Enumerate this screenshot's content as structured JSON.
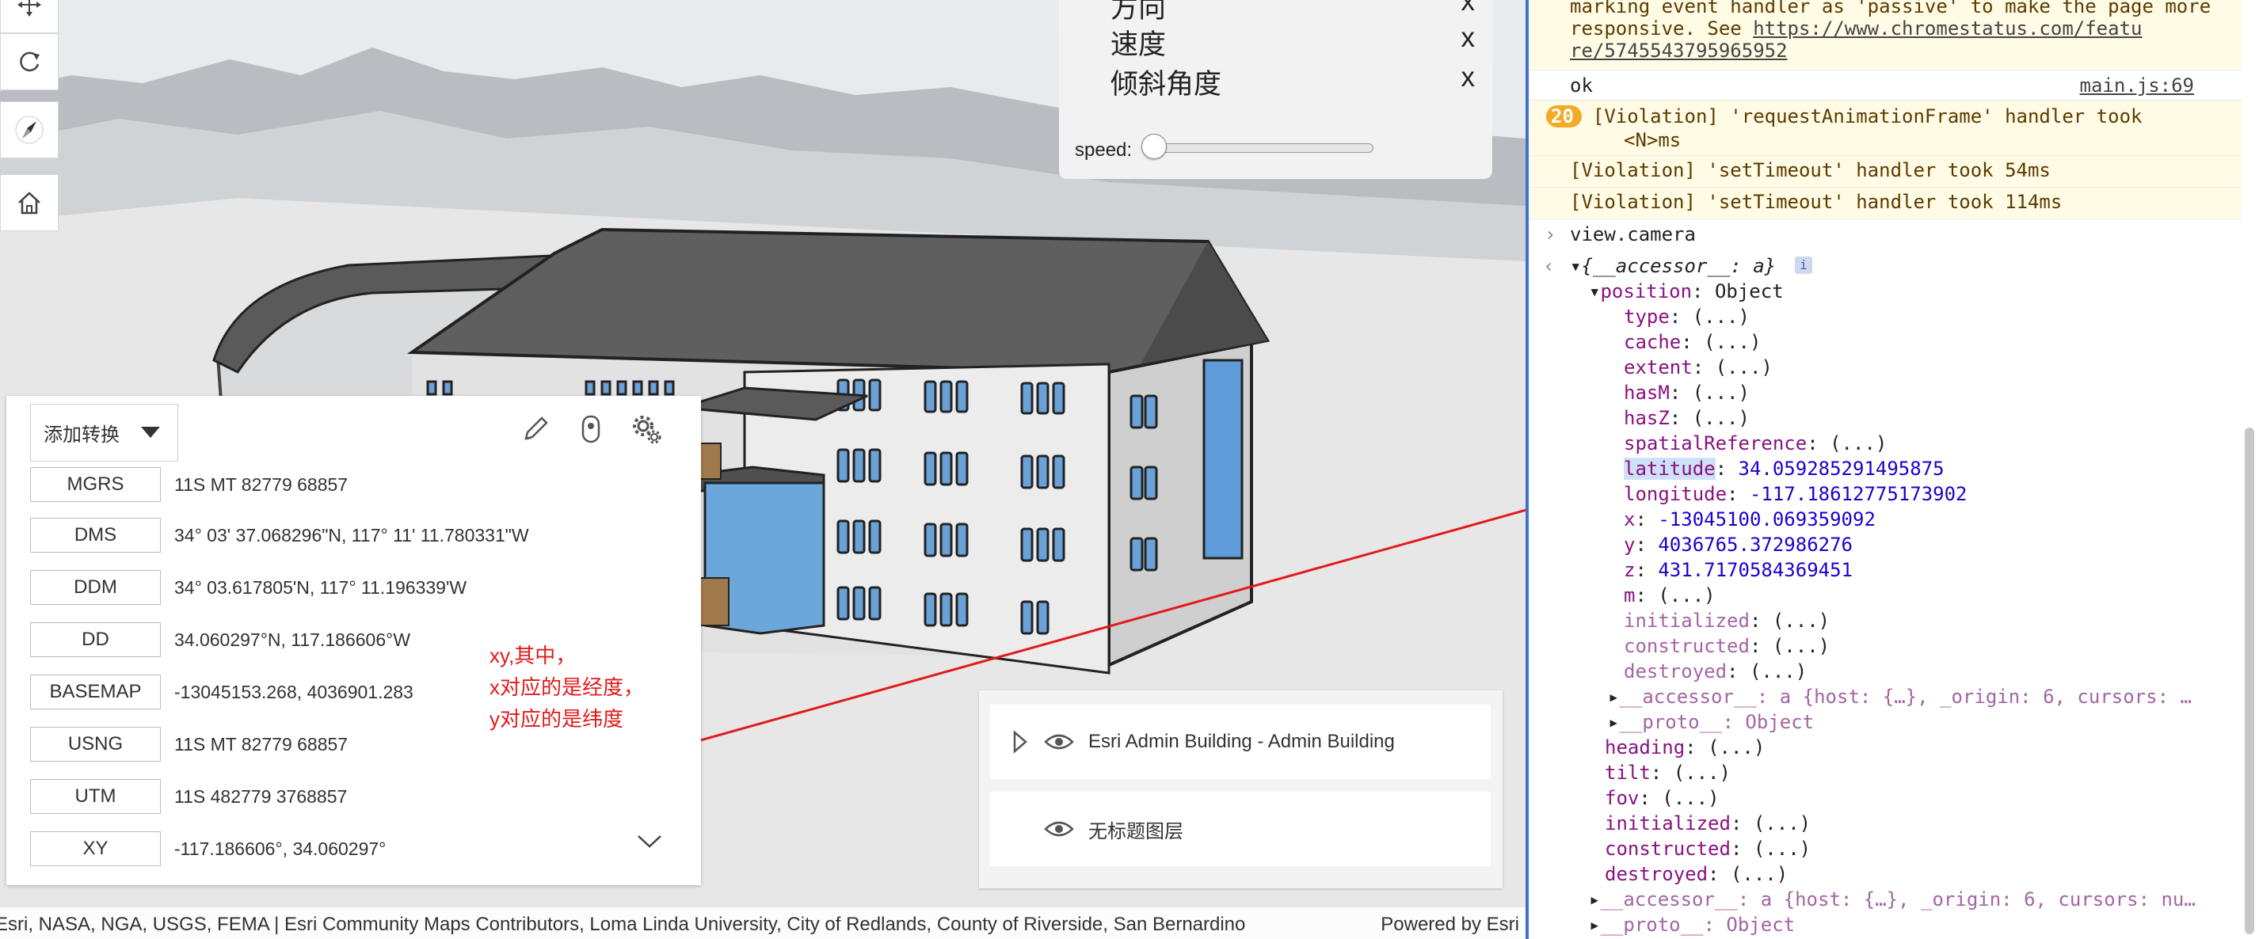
{
  "coordinate_widget": {
    "add_conversion_label": "添加转换",
    "rows": [
      {
        "format": "MGRS",
        "value": "11S MT 82779 68857"
      },
      {
        "format": "DMS",
        "value": "34° 03' 37.068296\"N, 117° 11' 11.780331\"W"
      },
      {
        "format": "DDM",
        "value": "34° 03.617805'N, 117° 11.196339'W"
      },
      {
        "format": "DD",
        "value": "34.060297°N, 117.186606°W"
      },
      {
        "format": "BASEMAP",
        "value": "-13045153.268, 4036901.283"
      },
      {
        "format": "USNG",
        "value": "11S MT 82779 68857"
      },
      {
        "format": "UTM",
        "value": "11S 482779 3768857"
      },
      {
        "format": "XY",
        "value": "-117.186606°, 34.060297°"
      }
    ]
  },
  "annotation": {
    "line1": "xy,其中，",
    "line2": "x对应的是经度，",
    "line3": "y对应的是纬度",
    "color": "#e21a1a"
  },
  "animation_panel": {
    "rows": [
      {
        "label": "方向",
        "close": "x"
      },
      {
        "label": "速度",
        "close": "x"
      },
      {
        "label": "倾斜角度",
        "close": "x"
      }
    ],
    "speed_label": "speed:",
    "speed_value": 0
  },
  "layer_list": {
    "layers": [
      {
        "title": "Esri Admin Building - Admin Building"
      },
      {
        "title": "无标题图层"
      }
    ]
  },
  "attribution": {
    "text": "Esri, NASA, NGA, USGS, FEMA | Esri Community Maps Contributors, Loma Linda University, City of Redlands, County of Riverside, San Bernardino",
    "powered_by": "Powered by Esri"
  },
  "console": {
    "warn_text": "marking event handler as 'passive' to make the page more responsive. See ",
    "warn_link_1": "https://www.chromestatus.com/featu",
    "warn_link_2": "re/5745543795965952",
    "ok_text": "ok",
    "ok_source": "main.js:69",
    "badge_count": "20",
    "violation_raf": "[Violation] 'requestAnimationFrame' handler took",
    "violation_raf_2": "<N>ms",
    "violation_timeout_1": "[Violation] 'setTimeout' handler took 54ms",
    "violation_timeout_2": "[Violation] 'setTimeout' handler took 114ms",
    "input_command": "view.camera",
    "result_summary": "{__accessor__: a}",
    "position_key": "position",
    "position_type": "Object",
    "lazy_props": [
      "type",
      "cache",
      "extent",
      "hasM",
      "hasZ",
      "spatialReference"
    ],
    "latitude_key": "latitude",
    "latitude_value": "34.059285291495875",
    "longitude_key": "longitude",
    "longitude_value": "-117.18612775173902",
    "x_key": "x",
    "x_value": "-13045100.069359092",
    "y_key": "y",
    "y_value": "4036765.372986276",
    "z_key": "z",
    "z_value": "431.7170584369451",
    "m_key": "m",
    "inner_lazy": [
      "initialized",
      "constructed",
      "destroyed"
    ],
    "accessor_inner": "__accessor__: a {host: {…}, _origin: 6, cursors: …",
    "proto_inner": "__proto__: Object",
    "camera_props": [
      "heading",
      "tilt",
      "fov",
      "initialized",
      "constructed",
      "destroyed"
    ],
    "accessor_outer": "__accessor__: a {host: {…}, _origin: 6, cursors: nu…",
    "proto_outer": "__proto__: Object",
    "lazy_value": "(...)"
  }
}
